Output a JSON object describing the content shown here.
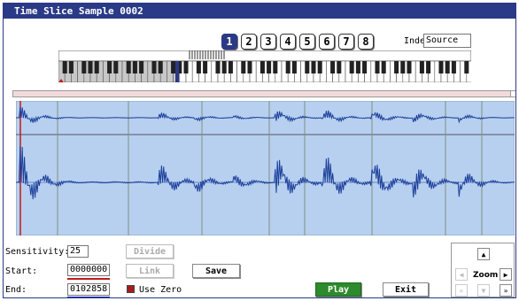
{
  "window": {
    "title": "Time Slice Sample 0002"
  },
  "pages": {
    "items": [
      "1",
      "2",
      "3",
      "4",
      "5",
      "6",
      "7",
      "8"
    ],
    "active": "1"
  },
  "index": {
    "label": "Index:",
    "value": "Source"
  },
  "controls": {
    "sensitivity": {
      "label": "Sensitivity:",
      "value": "25"
    },
    "start": {
      "label": "Start:",
      "value": "0000000"
    },
    "end": {
      "label": "End:",
      "value": "0102858"
    },
    "divide_label": "Divide",
    "link_label": "Link",
    "save_label": "Save",
    "use_zero_label": "Use Zero",
    "play_label": "Play",
    "exit_label": "Exit"
  },
  "zoom": {
    "label": "Zoom"
  },
  "colors": {
    "title_bar": "#2a3a86",
    "wave_bg": "#b7d0f0",
    "wave_line": "#1c3f9a",
    "slice_line": "#7f8f7f",
    "start_marker": "#c21818",
    "end_marker": "#1c2bc2",
    "play_button": "#2d8a2d"
  },
  "icons": [
    "arrow-up-icon",
    "arrow-left-icon",
    "arrow-right-icon",
    "arrow-down-icon",
    "skip-back-icon",
    "skip-forward-icon"
  ]
}
